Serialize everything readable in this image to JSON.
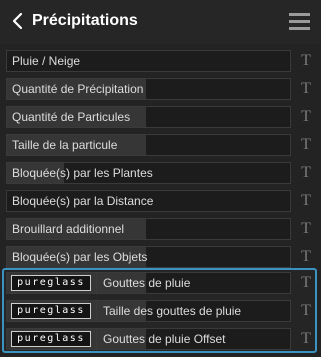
{
  "header": {
    "title": "Précipitations",
    "back_icon": "chevron-left-icon",
    "menu_icon": "hamburger-menu-icon"
  },
  "rows": [
    {
      "label": "Pluie / Neige",
      "fill": 0.0
    },
    {
      "label": "Quantité de Précipitation",
      "fill": 0.49
    },
    {
      "label": "Quantité de Particules",
      "fill": 0.49
    },
    {
      "label": "Taille de la particule",
      "fill": 0.49
    },
    {
      "label": "Bloquée(s) par les Plantes",
      "fill": 0.2
    },
    {
      "label": "Bloquée(s) par la Distance",
      "fill": 0.0
    },
    {
      "label": "Brouillard additionnel",
      "fill": 0.49
    },
    {
      "label": "Bloquée(s) par les Objets",
      "fill": 0.49
    }
  ],
  "pureglass": {
    "badge": "pureglass",
    "rows": [
      {
        "label": "Gouttes de pluie",
        "fill": 0.49
      },
      {
        "label": "Taille des gouttes de pluie",
        "fill": 0.49
      },
      {
        "label": "Gouttes de pluie Offset",
        "fill": 0.49
      }
    ]
  },
  "row_icon": "T",
  "colors": {
    "background": "#232323",
    "row_fill": "#363636",
    "panel_border": "#3a93c0"
  }
}
